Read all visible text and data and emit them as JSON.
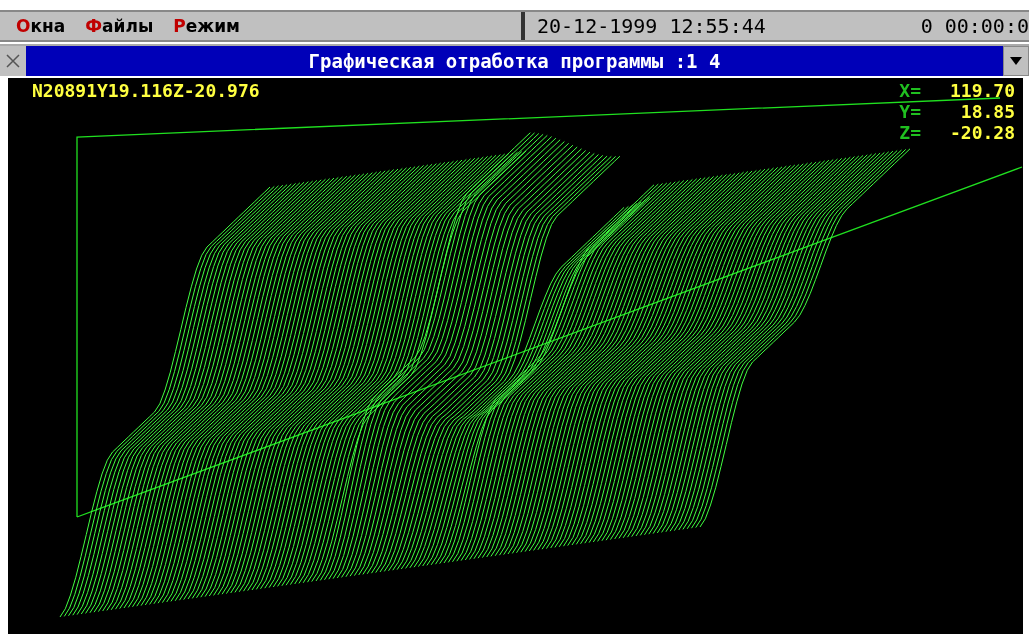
{
  "menu_bar": {
    "items": [
      {
        "label": "Окна"
      },
      {
        "label": "Файлы"
      },
      {
        "label": "Режим"
      }
    ],
    "clock": "20-12-1999 12:55:44",
    "timer": "0 00:00:0"
  },
  "window": {
    "title": "Графическая отработка программы :1 4",
    "program_line": "N20891Y19.116Z-20.976",
    "coordinates": [
      {
        "axis": "X=",
        "value": "119.70"
      },
      {
        "axis": "Y=",
        "value": "18.85"
      },
      {
        "axis": "Z=",
        "value": "-20.28"
      }
    ]
  }
}
